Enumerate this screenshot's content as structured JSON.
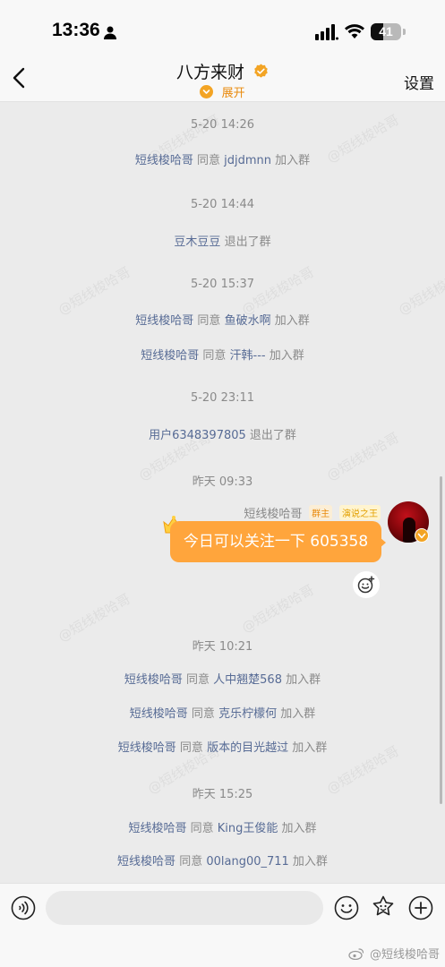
{
  "status_bar": {
    "time": "13:36",
    "battery": "41",
    "battery_level": 0.41
  },
  "header": {
    "title": "八方来财",
    "expand_label": "展开",
    "settings_label": "设置"
  },
  "messages": {
    "ts1": "5-20 14:26",
    "ev1": {
      "user": "短线梭哈哥",
      "verb": " 同意 ",
      "target": "jdjdmnn",
      "action": " 加入群"
    },
    "ts2": "5-20 14:44",
    "ev2": {
      "user": "豆木豆豆",
      "action": " 退出了群"
    },
    "ts3": "5-20 15:37",
    "ev3": {
      "user": "短线梭哈哥",
      "verb": " 同意 ",
      "target": "鱼破水啊",
      "action": " 加入群"
    },
    "ev4": {
      "user": "短线梭哈哥",
      "verb": " 同意 ",
      "target": "汗韩---",
      "action": " 加入群"
    },
    "ts4": "5-20 23:11",
    "ev5": {
      "user": "用户6348397805",
      "action": " 退出了群"
    },
    "ts5": "昨天 09:33",
    "chat": {
      "sender": "短线梭哈哥",
      "badge_owner": "群主",
      "badge_title": "演说之王",
      "text": "今日可以关注一下 605358"
    },
    "ts6": "昨天 10:21",
    "ev6": {
      "user": "短线梭哈哥",
      "verb": " 同意 ",
      "target": "人中翘楚568",
      "action": " 加入群"
    },
    "ev7": {
      "user": "短线梭哈哥",
      "verb": " 同意 ",
      "target": "克乐柠檬何",
      "action": " 加入群"
    },
    "ev8": {
      "user": "短线梭哈哥",
      "verb": " 同意 ",
      "target": "版本的目光越过",
      "action": " 加入群"
    },
    "ts7": "昨天 15:25",
    "ev9": {
      "user": "短线梭哈哥",
      "verb": " 同意 ",
      "target": "King王俊能",
      "action": " 加入群"
    },
    "ev10": {
      "user": "短线梭哈哥",
      "verb": " 同意 ",
      "target": "00lang00_711",
      "action": " 加入群"
    }
  },
  "watermark": "@短线梭哈哥",
  "corner_watermark": "@短线梭哈哥",
  "colors": {
    "accent": "#ffa53c",
    "link": "#576b95",
    "expand": "#e98a0c"
  }
}
